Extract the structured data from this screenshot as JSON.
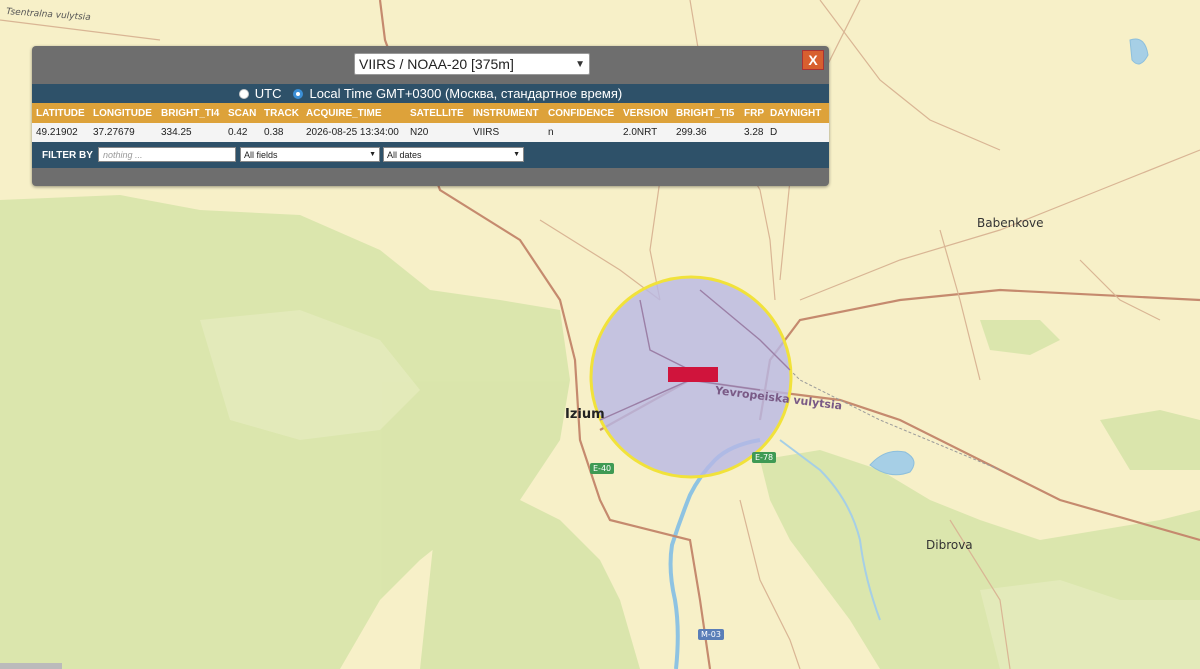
{
  "panel": {
    "dataset": "VIIRS / NOAA-20 [375m]",
    "close_label": "X",
    "time_options": {
      "utc": "UTC",
      "local": "Local Time GMT+0300 (Москва, стандартное время)"
    },
    "columns": [
      "LATITUDE",
      "LONGITUDE",
      "BRIGHT_TI4",
      "SCAN",
      "TRACK",
      "ACQUIRE_TIME",
      "SATELLITE",
      "INSTRUMENT",
      "CONFIDENCE",
      "VERSION",
      "BRIGHT_TI5",
      "FRP",
      "DAYNIGHT"
    ],
    "row": [
      "49.21902",
      "37.27679",
      "334.25",
      "0.42",
      "0.38",
      "2026-08-25 13:34:00",
      "N20",
      "VIIRS",
      "n",
      "2.0NRT",
      "299.36",
      "3.28",
      "D"
    ],
    "filter": {
      "label": "FILTER BY",
      "placeholder": "nothing ...",
      "field_select": "All fields",
      "date_select": "All dates"
    }
  },
  "map": {
    "places": {
      "izium": "Izium",
      "babenkove": "Babenkove",
      "dibrova": "Dibrova",
      "tsentralna": "Tsentralna vulytsia"
    },
    "road_label": "Yevropeiska vulytsia",
    "shields": {
      "e40": "E-40",
      "e78": "E-78",
      "m03": "M-03"
    },
    "colors": {
      "fire_marker": "#d0143c",
      "buffer_fill": "#b8b8e6",
      "buffer_stroke": "#f1e23a",
      "water": "#a6cfe6",
      "forest": "#d4e3a6"
    }
  }
}
